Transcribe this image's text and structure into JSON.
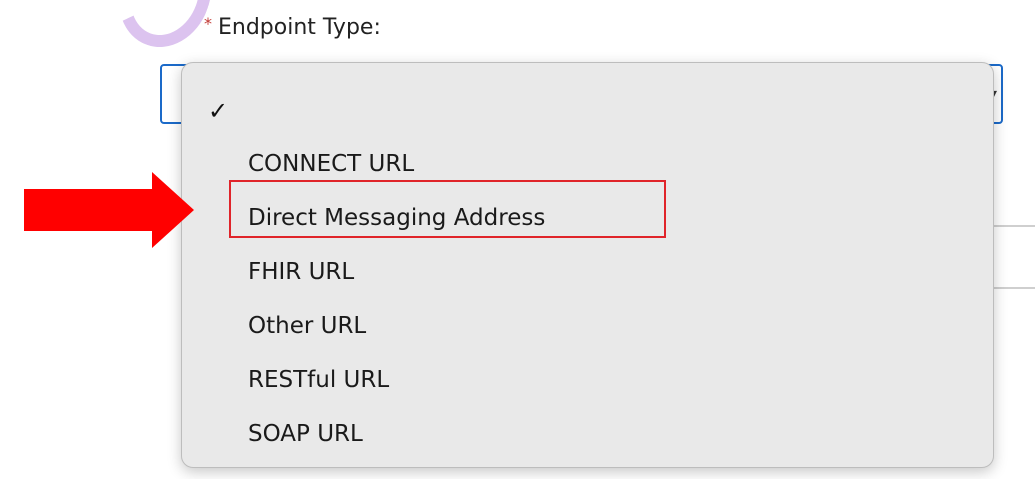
{
  "field": {
    "required_mark": "*",
    "label": "Endpoint Type:"
  },
  "dropdown": {
    "selected_check": "✓",
    "options": [
      "CONNECT URL",
      "Direct Messaging Address",
      "FHIR URL",
      "Other URL",
      "RESTful URL",
      "SOAP URL"
    ],
    "highlighted_option_index": 1
  },
  "icons": {
    "chevron": "chevron-down-icon",
    "arrow": "red-arrow-pointer",
    "check": "checkmark-icon"
  },
  "colors": {
    "highlight": "#e0242a",
    "arrow": "#ff0000",
    "focus_border": "#1b6ac9",
    "ring": "#dcc3ef",
    "required": "#c23934"
  }
}
